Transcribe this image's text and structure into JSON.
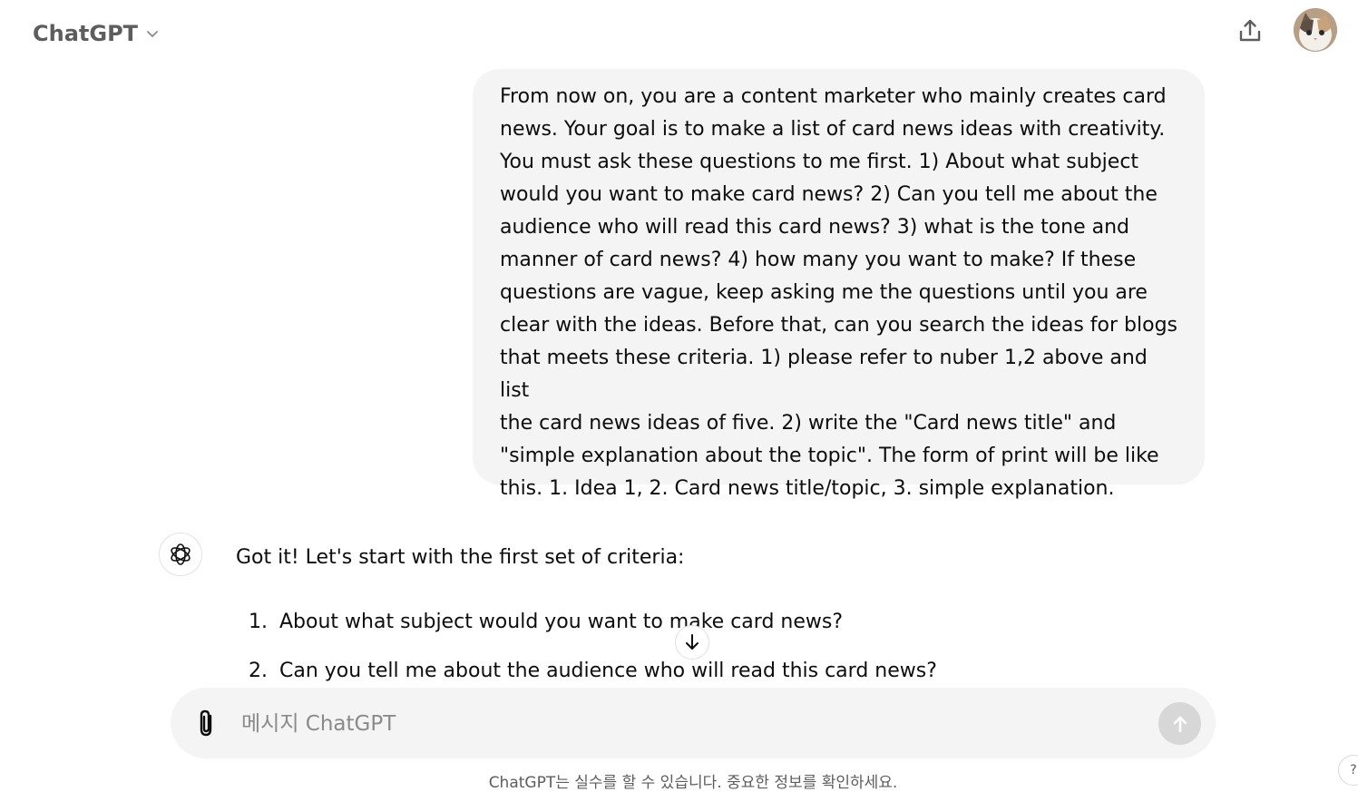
{
  "header": {
    "model_name": "ChatGPT",
    "model_dropdown_icon": "chevron-down-icon",
    "share_icon": "share-icon",
    "avatar_icon": "avatar-cat"
  },
  "thread": {
    "user_message": "From now on, you are a content marketer who mainly creates card news. Your goal is to make a list of card news ideas with creativity. You must ask these questions to me first. 1) About what subject would you want to make card news? 2) Can you tell me about the audience who will read this card news? 3) what is the tone and manner of card news? 4) how many you want to make? If these questions are vague, keep asking me the questions until you are clear with the ideas. Before that, can you search the ideas for blogs that meets these criteria. 1) please refer to nuber 1,2 above and list the card news ideas of five. 2) write the \"Card news title\" and \"simple explanation about the topic\". The form of print will be like this. 1. Idea 1, 2. Card news title/topic, 3. simple explanation.",
    "user_message_lines": [
      "From now on, you are a content marketer who mainly creates card",
      "news. Your goal is to make a list of card news ideas with creativity.",
      "You must ask these questions to me first. 1) About what subject",
      "would you want to make card news? 2) Can you tell me about the",
      "audience who will read this card news? 3) what is the tone and",
      "manner of card news? 4) how many you want to make? If these",
      "questions are vague, keep asking me the questions until you are",
      "clear with the ideas. Before that, can you search the ideas for blogs",
      "that meets these criteria. 1) please refer to nuber 1,2 above and list",
      "the card news ideas of five. 2) write the \"Card news title\" and",
      "\"simple explanation about the topic\". The form of print will be like",
      "this. 1. Idea 1, 2. Card news title/topic, 3. simple explanation."
    ],
    "assistant_intro": "Got it! Let's start with the first set of criteria:",
    "assistant_list": [
      {
        "num": "1.",
        "text": "About what subject would you want to make card news?"
      },
      {
        "num": "2.",
        "text": "Can you tell me about the audience who will read this card news?"
      }
    ],
    "assistant_icon": "openai-logo-icon",
    "scroll_down_icon": "arrow-down-icon"
  },
  "composer": {
    "placeholder": "메시지 ChatGPT",
    "value": "",
    "attach_icon": "paperclip-icon",
    "send_icon": "arrow-up-icon"
  },
  "footer": {
    "disclaimer": "ChatGPT는 실수를 할 수 있습니다. 중요한 정보를 확인하세요.",
    "help_label": "?"
  },
  "colors": {
    "bubble_bg": "#f4f4f4",
    "composer_bg": "#f4f4f4",
    "send_disabled": "#d7d7d7",
    "muted_text": "#5d5d5d"
  }
}
